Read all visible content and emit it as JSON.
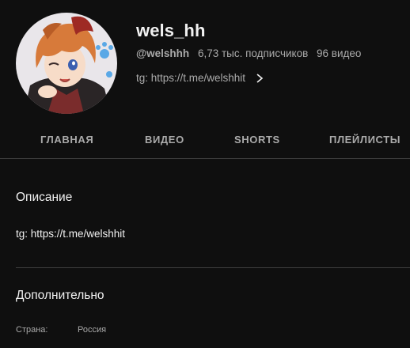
{
  "channel": {
    "name": "wels_hh",
    "handle": "@welshhh",
    "subscribers": "6,73 тыс. подписчиков",
    "videos": "96 видео",
    "link": "tg: https://t.me/welshhit"
  },
  "tabs": [
    {
      "label": "ГЛАВНАЯ"
    },
    {
      "label": "ВИДЕО"
    },
    {
      "label": "SHORTS"
    },
    {
      "label": "ПЛЕЙЛИСТЫ"
    }
  ],
  "about": {
    "description_title": "Описание",
    "description_text": "tg: https://t.me/welshhit",
    "details_title": "Дополнительно",
    "details": [
      {
        "label": "Страна:",
        "value": "Россия"
      }
    ]
  },
  "icons": {
    "link_chevron": "chevron-right-icon"
  },
  "colors": {
    "background": "#0f0f0f",
    "text_primary": "#f1f1f1",
    "text_secondary": "#aaaaaa",
    "divider": "#3f3f3f"
  }
}
